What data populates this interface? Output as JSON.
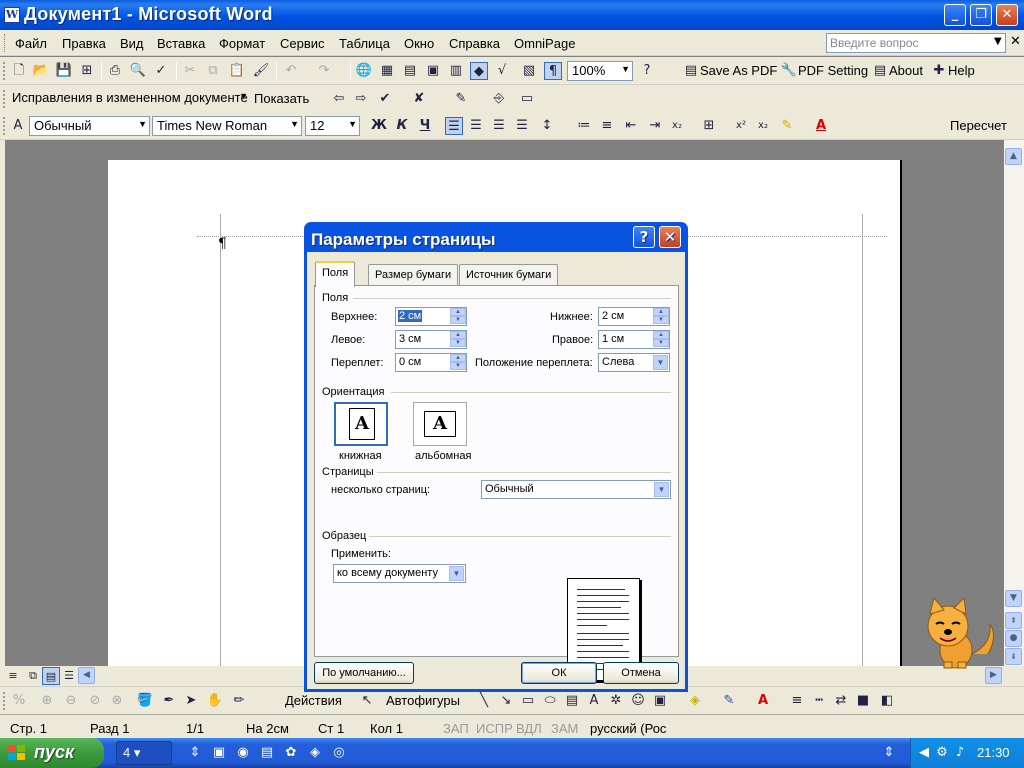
{
  "window": {
    "title": "Документ1 - Microsoft Word",
    "min": "_",
    "restore": "❐",
    "close": "✕",
    "app_icon": "W"
  },
  "menubar": {
    "items": [
      "Файл",
      "Правка",
      "Вид",
      "Вставка",
      "Формат",
      "Сервис",
      "Таблица",
      "Окно",
      "Справка",
      "OmniPage"
    ],
    "help_placeholder": "Введите вопрос"
  },
  "toolbar1": {
    "zoom": "100%",
    "save_as_pdf": "Save As PDF",
    "pdf_setting": "PDF Setting",
    "about": "About",
    "help": "Help"
  },
  "toolbar2": {
    "track_changes_mode": "Исправления в измененном документе",
    "show": "Показать"
  },
  "toolbar3": {
    "style": "Обычный",
    "font": "Times New Roman",
    "size": "12",
    "bold": "Ж",
    "italic": "К",
    "underline": "Ч",
    "recount": "Пересчет"
  },
  "document": {
    "pilcrow": "¶"
  },
  "drawbar": {
    "actions": "Действия",
    "autoshapes": "Автофигуры"
  },
  "status": {
    "page": "Стр. 1",
    "section": "Разд 1",
    "pages": "1/1",
    "at": "На 2см",
    "line": "Ст 1",
    "col": "Кол 1",
    "rec": "ЗАП",
    "trk": "ИСПР",
    "ext": "ВДЛ",
    "ovr": "ЗАМ",
    "language": "русский (Рос"
  },
  "taskbar": {
    "start": "пуск",
    "task_group_count": "4",
    "clock": "21:30"
  },
  "dialog": {
    "title": "Параметры страницы",
    "help": "?",
    "close": "✕",
    "tabs": [
      "Поля",
      "Размер бумаги",
      "Источник бумаги"
    ],
    "margins_group": "Поля",
    "top_label": "Верхнее:",
    "top_value": "2 см",
    "bottom_label": "Нижнее:",
    "bottom_value": "2 см",
    "left_label": "Левое:",
    "left_value": "3 см",
    "right_label": "Правое:",
    "right_value": "1 см",
    "gutter_label": "Переплет:",
    "gutter_value": "0 см",
    "gutter_pos_label": "Положение переплета:",
    "gutter_pos_value": "Слева",
    "orientation_group": "Ориентация",
    "portrait": "книжная",
    "landscape": "альбомная",
    "orient_letter": "A",
    "pages_group": "Страницы",
    "multiple_pages_label": "несколько страниц:",
    "multiple_pages_value": "Обычный",
    "preview_group": "Образец",
    "apply_label": "Применить:",
    "apply_value": "ко всему документу",
    "default_button": "По умолчанию...",
    "ok": "ОК",
    "cancel": "Отмена"
  }
}
